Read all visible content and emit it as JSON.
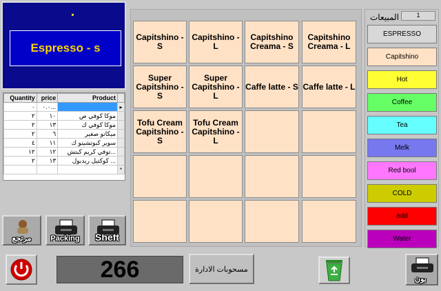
{
  "display": {
    "text": "Espresso - s",
    "dot": "."
  },
  "grid": {
    "headers": [
      "Quantity",
      "price",
      "Product"
    ],
    "rows": [
      [
        "٠",
        "٠.٠...",
        ""
      ],
      [
        "٢",
        "١٠",
        "موكا كوفي  ص"
      ],
      [
        "٢",
        "١٣",
        "موكا كوفي  ك"
      ],
      [
        "٢",
        "٦",
        "ميكانو  صغير"
      ],
      [
        "٤",
        "١١",
        "سوبر كبوتشينو ك"
      ],
      [
        "١٢",
        "١٢",
        "توفي كريم كبتش..."
      ],
      [
        "٢",
        "١٣",
        "كوكتيل ريدبول ..."
      ]
    ],
    "current_row_indicator": "▸",
    "new_row_indicator": "*"
  },
  "left_buttons": {
    "returns": "مرتجع",
    "packing": "Packing",
    "shift": "Sheft"
  },
  "products": [
    [
      "Capitshino - S",
      "Capitshino - L",
      "Capitshino Creama - S",
      "Capitshino Creama - L"
    ],
    [
      "Super Capitshino - S",
      "Super Capitshino - L",
      "Caffe latte - S",
      "Caffe latte - L"
    ],
    [
      "Tofu Cream Capitshino - S",
      "Tofu Cream Capitshino - L",
      "",
      ""
    ],
    [
      "",
      "",
      "",
      ""
    ],
    [
      "",
      "",
      "",
      ""
    ]
  ],
  "sales": {
    "label": "المبيعات",
    "count": "1"
  },
  "categories": [
    {
      "label": "ESPRESSO",
      "color": "#d8d8d8"
    },
    {
      "label": "Capitshino",
      "color": "#ffe2c6"
    },
    {
      "label": "Hot",
      "color": "#ffff33"
    },
    {
      "label": "Coffee",
      "color": "#66ff66"
    },
    {
      "label": "Tea",
      "color": "#66ffff"
    },
    {
      "label": "Melk",
      "color": "#7777ee"
    },
    {
      "label": "Red bool",
      "color": "#ff77ff"
    },
    {
      "label": "COLD",
      "color": "#cccc00"
    },
    {
      "label": "add",
      "color": "#ff0000"
    },
    {
      "label": "Water",
      "color": "#bb00bb"
    }
  ],
  "total": "266",
  "admin_button": "مسحوبات الادارة",
  "print_button": "بون"
}
